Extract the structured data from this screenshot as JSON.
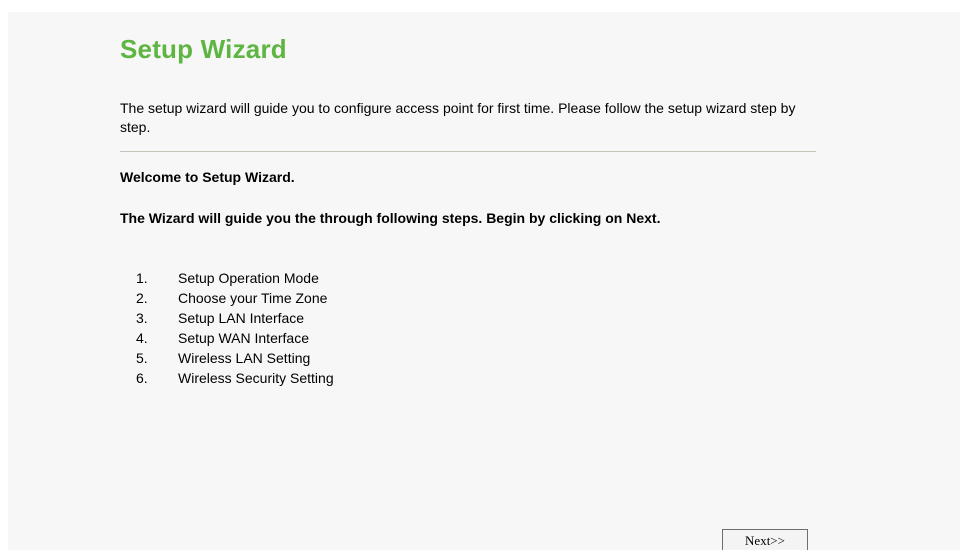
{
  "header": {
    "title": "Setup Wizard"
  },
  "intro": {
    "text": "The setup wizard will guide you to configure access point for first time. Please follow the setup wizard step by step."
  },
  "welcome": {
    "text": "Welcome to Setup Wizard."
  },
  "guide": {
    "text": "The Wizard will guide you the through following steps. Begin by clicking on Next."
  },
  "steps": [
    {
      "num": "1.",
      "label": "Setup Operation Mode"
    },
    {
      "num": "2.",
      "label": "Choose your Time Zone"
    },
    {
      "num": "3.",
      "label": "Setup LAN Interface"
    },
    {
      "num": "4.",
      "label": "Setup WAN Interface"
    },
    {
      "num": "5.",
      "label": "Wireless LAN Setting"
    },
    {
      "num": "6.",
      "label": "Wireless Security Setting"
    }
  ],
  "actions": {
    "next_label": "Next>>"
  },
  "colors": {
    "title": "#5db542",
    "background": "#f7f7f7",
    "divider": "#c4c4b8"
  }
}
